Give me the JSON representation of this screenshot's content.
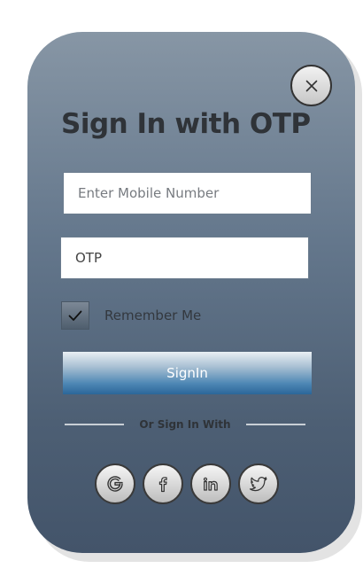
{
  "dialog": {
    "title": "Sign In with OTP",
    "close_icon": "close-icon"
  },
  "form": {
    "mobile_placeholder": "Enter Mobile Number",
    "mobile_value": "",
    "otp_placeholder": "OTP",
    "otp_value": "OTP",
    "remember_label": "Remember Me",
    "remember_checked": true,
    "signin_label": "SignIn"
  },
  "social": {
    "divider_text": "Or Sign In With",
    "buttons": [
      {
        "name": "google",
        "icon": "google-icon"
      },
      {
        "name": "facebook",
        "icon": "facebook-icon"
      },
      {
        "name": "linkedin",
        "icon": "linkedin-icon"
      },
      {
        "name": "twitter",
        "icon": "twitter-icon"
      }
    ]
  },
  "colors": {
    "card_top": "#8796a5",
    "card_bottom": "#43546a",
    "button_accent": "#2b6699",
    "title_text": "#2f3338"
  }
}
